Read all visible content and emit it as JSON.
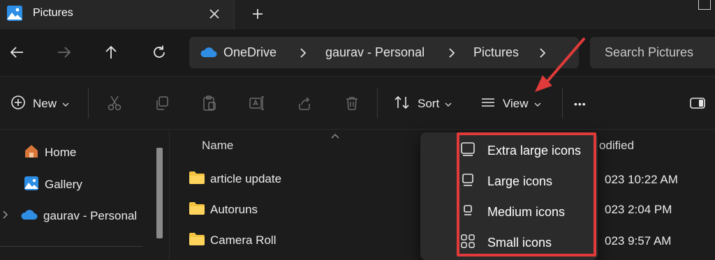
{
  "window": {
    "tab_title": "Pictures",
    "new_tab_symbol": "+"
  },
  "navigation": {
    "breadcrumbs": [
      "OneDrive",
      "gaurav - Personal",
      "Pictures"
    ],
    "search_placeholder": "Search Pictures"
  },
  "command_bar": {
    "new_label": "New",
    "sort_label": "Sort",
    "view_label": "View",
    "more_symbol": "•••"
  },
  "sidebar": {
    "items": [
      {
        "label": "Home",
        "icon": "home-icon"
      },
      {
        "label": "Gallery",
        "icon": "gallery-icon"
      },
      {
        "label": "gaurav - Personal",
        "icon": "onedrive-cloud-icon"
      }
    ]
  },
  "file_list": {
    "columns": {
      "name": "Name",
      "modified": "odified"
    },
    "rows": [
      {
        "name": "article update",
        "modified": "023 10:22 AM"
      },
      {
        "name": "Autoruns",
        "modified": "023 2:04 PM"
      },
      {
        "name": "Camera Roll",
        "modified": "023 9:57 AM"
      }
    ]
  },
  "view_menu": {
    "items": [
      {
        "label": "Extra large icons",
        "icon": "extra-large-icons-icon"
      },
      {
        "label": "Large icons",
        "icon": "large-icons-icon"
      },
      {
        "label": "Medium icons",
        "icon": "medium-icons-icon"
      },
      {
        "label": "Small icons",
        "icon": "small-icons-icon"
      }
    ]
  },
  "colors": {
    "accent_blue": "#2d8ee6",
    "annotation_red": "#e03a3a",
    "folder_yellow": "#f4c441"
  }
}
